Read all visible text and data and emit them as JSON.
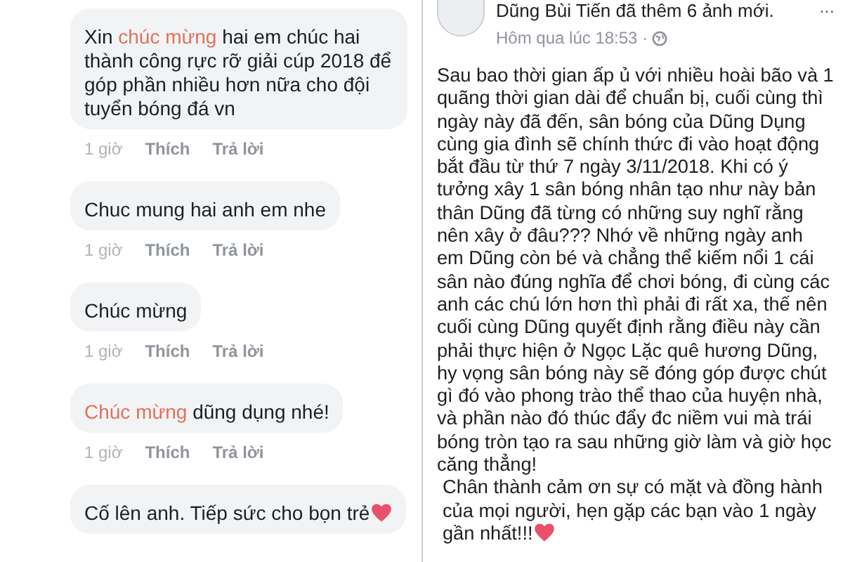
{
  "comments": [
    {
      "segments": [
        {
          "text": "Xin ",
          "highlight": false
        },
        {
          "text": "chúc mừng",
          "highlight": true
        },
        {
          "text": " hai em chúc hai thành công rực rỡ giải cúp 2018 để góp phần nhiều hơn nữa cho đội tuyển bóng đá vn",
          "highlight": false
        }
      ],
      "time": "1 giờ",
      "like": "Thích",
      "reply": "Trả lời",
      "heart": false
    },
    {
      "segments": [
        {
          "text": "Chuc mung hai anh em nhe",
          "highlight": false
        }
      ],
      "time": "1 giờ",
      "like": "Thích",
      "reply": "Trả lời",
      "heart": false
    },
    {
      "segments": [
        {
          "text": "Chúc mừng",
          "highlight": false
        }
      ],
      "time": "1 giờ",
      "like": "Thích",
      "reply": "Trả lời",
      "heart": false
    },
    {
      "segments": [
        {
          "text": "Chúc mừng",
          "highlight": true
        },
        {
          "text": " dũng dụng nhé!",
          "highlight": false
        }
      ],
      "time": "1 giờ",
      "like": "Thích",
      "reply": "Trả lời",
      "heart": false
    },
    {
      "segments": [
        {
          "text": "Cố lên anh. Tiếp sức cho bọn trẻ",
          "highlight": false
        }
      ],
      "heart": true
    }
  ],
  "post": {
    "author_line": "Dũng Bùi Tiến đã thêm 6 ảnh mới.",
    "timestamp": "Hôm qua lúc 18:53 ·",
    "menu": "...",
    "paragraphs": [
      {
        "text": "Sau bao thời gian ấp ủ với nhiều hoài bão và 1 quãng thời gian dài để chuẩn bị, cuối cùng thì ngày này đã đến, sân bóng của Dũng Dụng cùng gia đình sẽ chính thức đi vào hoạt động bắt đầu từ thứ 7 ngày 3/11/2018. Khi có ý tưởng xây 1 sân bóng nhân tạo như này bản thân Dũng đã từng có những suy nghĩ rằng nên xây ở đâu??? Nhớ về những ngày anh em Dũng còn bé và chẳng thể kiếm nổi 1 cái sân nào đúng nghĩa để chơi bóng, đi cùng các anh các chú lớn hơn thì phải đi rất xa, thế nên cuối cùng Dũng quyết định rằng điều này cần phải thực hiện ở Ngọc Lặc quê hương Dũng, hy vọng sân bóng này sẽ đóng góp được chút gì đó vào phong trào thể thao của huyện nhà, và phần nào đó thúc đẩy đc niềm vui mà trái bóng tròn tạo ra sau những giờ làm và giờ học căng thẳng!",
        "heart": false
      },
      {
        "text": "Chân thành cảm ơn sự có mặt và đồng hành của mọi người, hẹn gặp các bạn vào 1 ngày gần nhất!!!",
        "heart": true
      }
    ]
  }
}
